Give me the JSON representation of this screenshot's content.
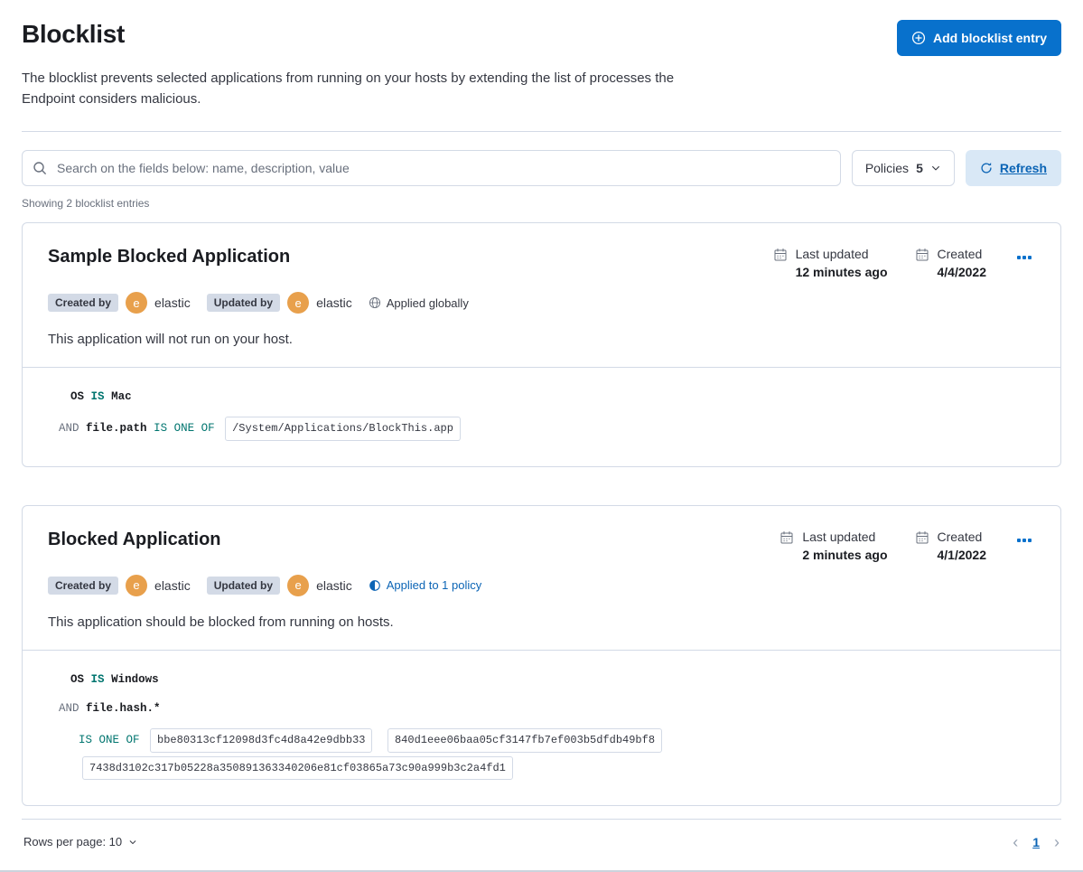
{
  "colors": {
    "primary": "#0871cc",
    "avatar_orange": "#e8a04c",
    "keyword_teal": "#00756f",
    "badge_gray": "#d3dae6"
  },
  "page": {
    "title": "Blocklist",
    "description": "The blocklist prevents selected applications from running on your hosts by extending the list of processes the Endpoint considers malicious.",
    "add_button_label": "Add blocklist entry",
    "showing_text": "Showing 2 blocklist entries"
  },
  "toolbar": {
    "search_placeholder": "Search on the fields below: name, description, value",
    "policies_label": "Policies",
    "policies_count": "5",
    "refresh_label": "Refresh"
  },
  "icons": {
    "add": "plus-in-circle",
    "search": "magnifier",
    "refresh": "circular-arrow",
    "date": "calendar",
    "global": "globe",
    "policy": "half-circle",
    "menu": "boxes-horizontal"
  },
  "entries": [
    {
      "title": "Sample Blocked Application",
      "last_updated_label": "Last updated",
      "last_updated_value": "12 minutes ago",
      "created_label": "Created",
      "created_value": "4/4/2022",
      "created_by_label": "Created by",
      "created_by_user": "elastic",
      "updated_by_label": "Updated by",
      "updated_by_user": "elastic",
      "avatar_initial": "e",
      "scope_label": "Applied globally",
      "description": "This application will not run on your host.",
      "conditions": {
        "os_field": "OS",
        "os_operator": "IS",
        "os_value": "Mac",
        "conjunction": "AND",
        "field": "file.path",
        "operator": "IS ONE OF",
        "values": [
          "/System/Applications/BlockThis.app"
        ]
      }
    },
    {
      "title": "Blocked Application",
      "last_updated_label": "Last updated",
      "last_updated_value": "2 minutes ago",
      "created_label": "Created",
      "created_value": "4/1/2022",
      "created_by_label": "Created by",
      "created_by_user": "elastic",
      "updated_by_label": "Updated by",
      "updated_by_user": "elastic",
      "avatar_initial": "e",
      "scope_label": "Applied to 1 policy",
      "description": "This application should be blocked from running on hosts.",
      "conditions": {
        "os_field": "OS",
        "os_operator": "IS",
        "os_value": "Windows",
        "conjunction": "AND",
        "field": "file.hash.*",
        "operator": "IS ONE OF",
        "values": [
          "bbe80313cf12098d3fc4d8a42e9dbb33",
          "840d1eee06baa05cf3147fb7ef003b5dfdb49bf8",
          "7438d3102c317b05228a350891363340206e81cf03865a73c90a999b3c2a4fd1"
        ]
      }
    }
  ],
  "footer": {
    "rows_per_page_label": "Rows per page: 10",
    "page_number": "1",
    "prev_icon": "‹",
    "next_icon": "›"
  }
}
